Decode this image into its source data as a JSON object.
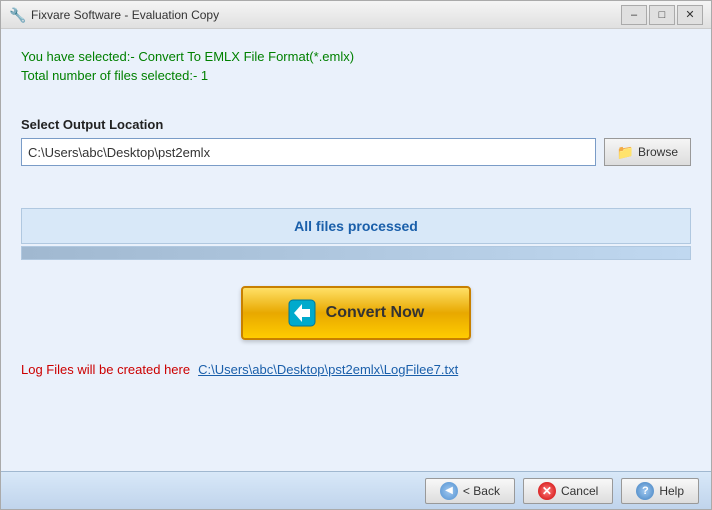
{
  "window": {
    "title": "Fixvare Software - Evaluation Copy"
  },
  "info": {
    "line1": "You have selected:- Convert To EMLX File Format(*.emlx)",
    "line2": "Total number of files selected:- 1"
  },
  "output": {
    "label": "Select Output Location",
    "path": "C:\\Users\\abc\\Desktop\\pst2emlx",
    "browse_label": "Browse"
  },
  "status": {
    "text": "All files processed"
  },
  "convert": {
    "label": "Convert Now"
  },
  "log": {
    "label": "Log Files will be created here",
    "link": "C:\\Users\\abc\\Desktop\\pst2emlx\\LogFilee7.txt"
  },
  "footer": {
    "back_label": "< Back",
    "cancel_label": "Cancel",
    "help_label": "Help"
  },
  "icons": {
    "app": "🔧",
    "browse": "📁",
    "convert_arrow": "▶",
    "minimize": "–",
    "maximize": "□",
    "close": "✕",
    "back_arrow": "◀",
    "cancel_x": "✕",
    "help_q": "?"
  }
}
